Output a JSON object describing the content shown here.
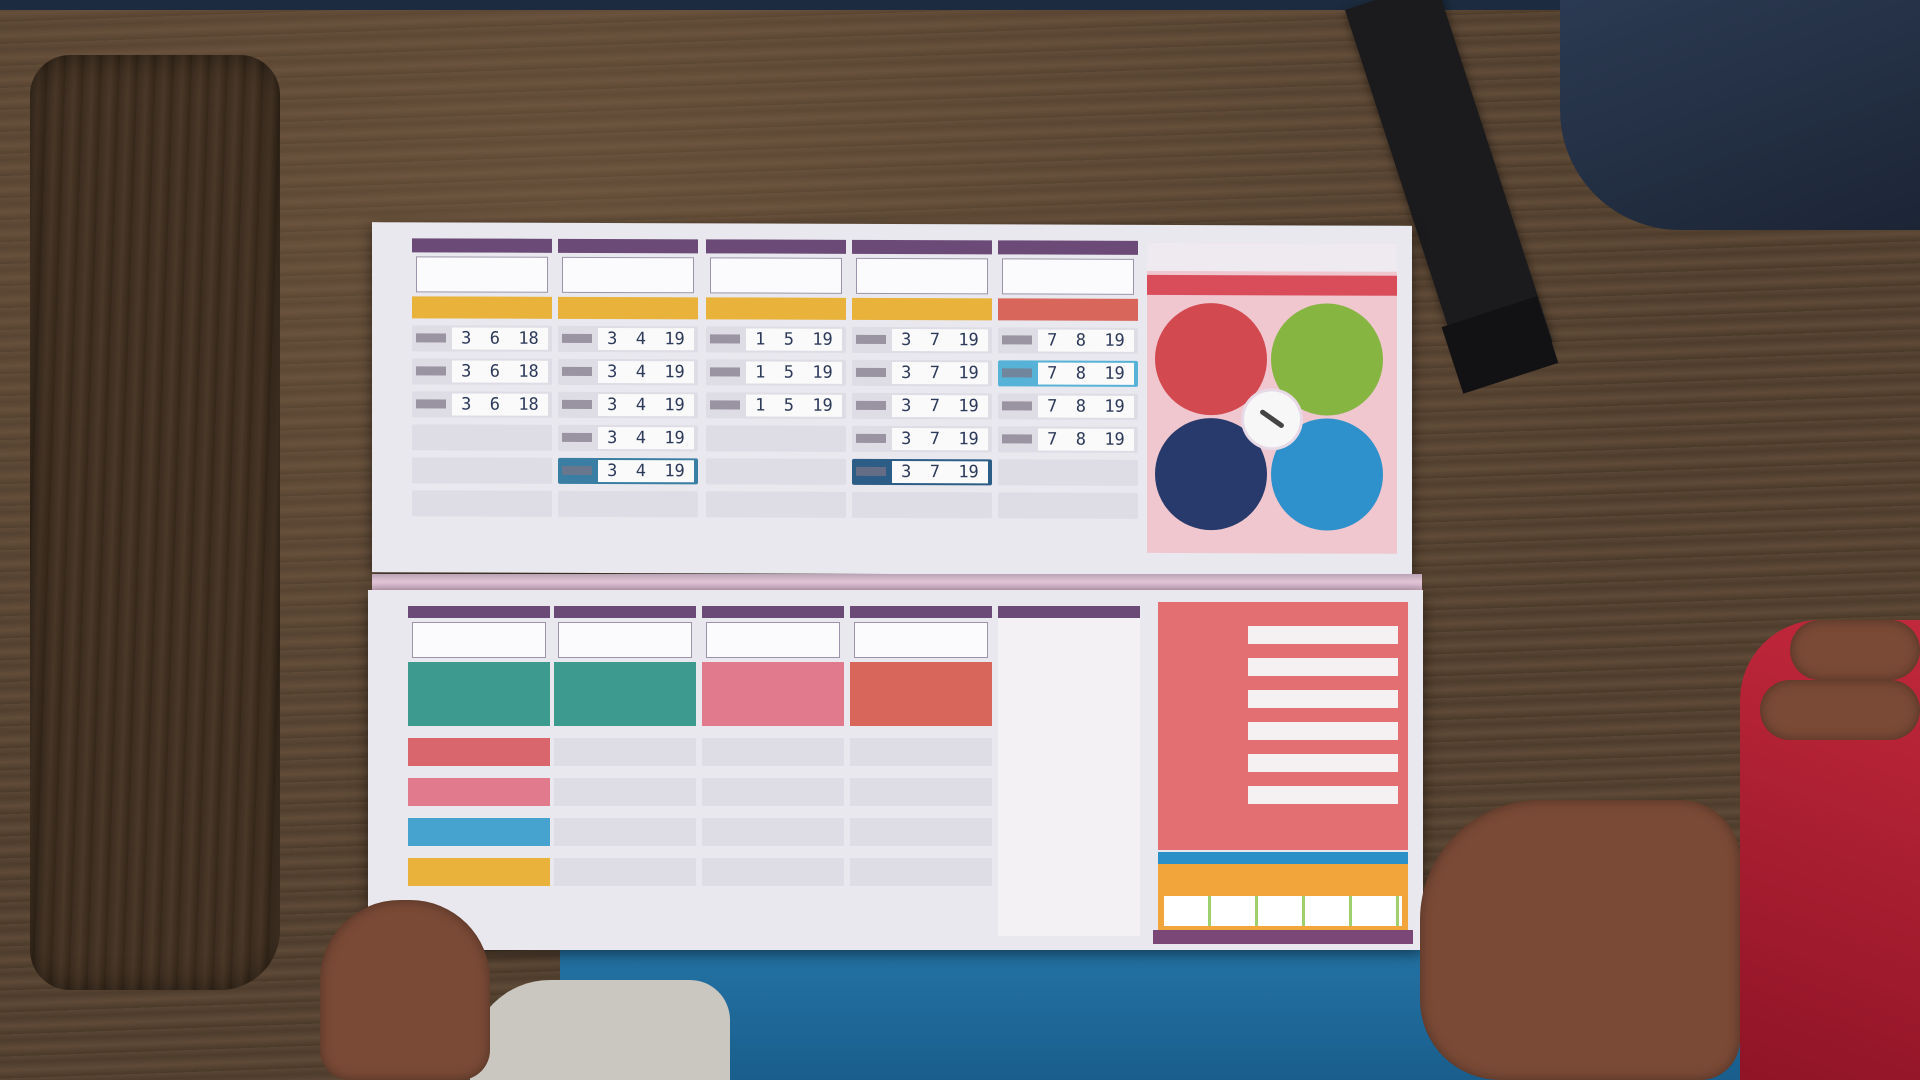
{
  "photo": {
    "description_tag": "open vaccination record booklet on wooden bench",
    "colors": {
      "wood": "#4b3a2b",
      "page": "#e9e8ee",
      "header_purple": "#6c4a78",
      "yellow_band": "#e8b23b",
      "salmon_band": "#d9665a",
      "teal_band": "#3c9a8f",
      "pink_band": "#e07a8c",
      "blue_band": "#2f7fb4"
    }
  },
  "top_page": {
    "columns": [
      {
        "rows": [
          [
            "3",
            "6",
            "18"
          ],
          [
            "3",
            "6",
            "18"
          ],
          [
            "3",
            "6",
            "18"
          ]
        ]
      },
      {
        "rows": [
          [
            "3",
            "4",
            "19"
          ],
          [
            "3",
            "4",
            "19"
          ],
          [
            "3",
            "4",
            "19"
          ],
          [
            "3",
            "4",
            "19"
          ],
          [
            "3",
            "4",
            "19"
          ]
        ]
      },
      {
        "rows": [
          [
            "1",
            "5",
            "19"
          ],
          [
            "1",
            "5",
            "19"
          ],
          [
            "1",
            "5",
            "19"
          ]
        ]
      },
      {
        "rows": [
          [
            "3",
            "7",
            "19"
          ],
          [
            "3",
            "7",
            "19"
          ],
          [
            "3",
            "7",
            "19"
          ],
          [
            "3",
            "7",
            "19"
          ],
          [
            "3",
            "7",
            "19"
          ]
        ]
      },
      {
        "rows": [
          [
            "7",
            "8",
            "19"
          ],
          [
            "7",
            "8",
            "19"
          ],
          [
            "7",
            "8",
            "19"
          ],
          [
            "7",
            "8",
            "19"
          ]
        ]
      }
    ]
  }
}
